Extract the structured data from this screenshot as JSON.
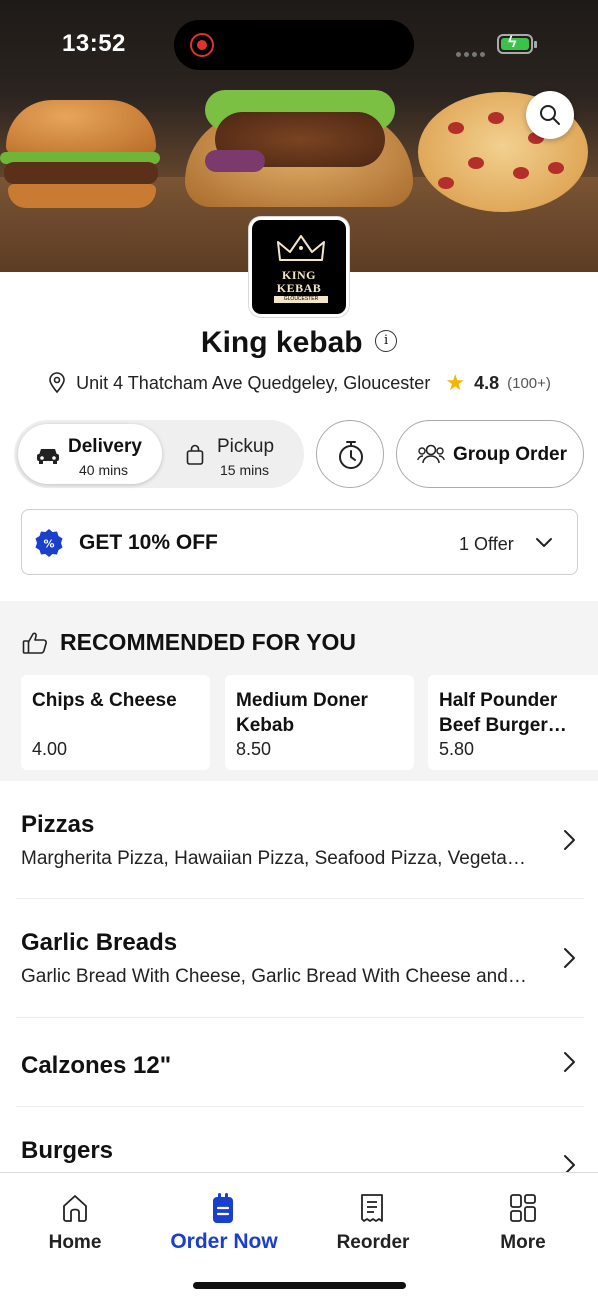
{
  "status_bar": {
    "time": "13:52"
  },
  "hero": {
    "logo": {
      "line1": "KING",
      "line2": "KEBAB",
      "line3": "GLOUCESTER"
    }
  },
  "restaurant": {
    "name": "King kebab",
    "address": "Unit 4 Thatcham Ave Quedgeley, Gloucester",
    "rating": "4.8",
    "rating_count": "(100+)"
  },
  "order_modes": {
    "delivery": {
      "label": "Delivery",
      "time": "40 mins",
      "selected": true
    },
    "pickup": {
      "label": "Pickup",
      "time": "15 mins",
      "selected": false
    }
  },
  "group_order_label": "Group Order",
  "offer": {
    "title": "GET 10% OFF",
    "count": "1 Offer"
  },
  "recommended": {
    "heading": "RECOMMENDED FOR YOU",
    "items": [
      {
        "name": "Chips & Cheese",
        "price": "4.00"
      },
      {
        "name": "Medium Doner Kebab",
        "price": "8.50"
      },
      {
        "name": "Half Pounder Beef Burger With",
        "price": "5.80"
      }
    ]
  },
  "categories": [
    {
      "title": "Pizzas",
      "desc": "Margherita Pizza, Hawaiian Pizza, Seafood Pizza, Vegetarian Pizza"
    },
    {
      "title": "Garlic Breads",
      "desc": "Garlic Bread With Cheese, Garlic Bread With Cheese and Tomato"
    },
    {
      "title": "Calzones 12\"",
      "desc": ""
    },
    {
      "title": "Burgers",
      "desc": ""
    }
  ],
  "tabs": [
    {
      "label": "Home",
      "icon": "home-icon",
      "active": false
    },
    {
      "label": "Order Now",
      "icon": "order-icon",
      "active": true
    },
    {
      "label": "Reorder",
      "icon": "receipt-icon",
      "active": false
    },
    {
      "label": "More",
      "icon": "grid-icon",
      "active": false
    }
  ],
  "colors": {
    "accent": "#1a3fcc",
    "star": "#f5b400",
    "section_bg": "#f4f4f4"
  }
}
